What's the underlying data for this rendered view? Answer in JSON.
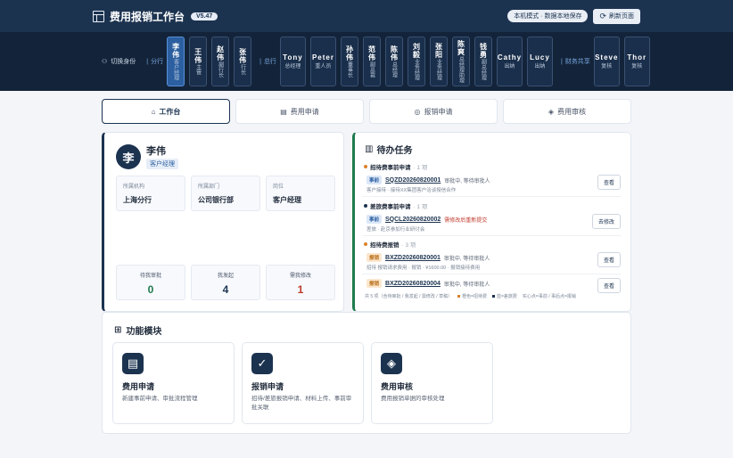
{
  "header": {
    "title": "费用报销工作台",
    "version": "V5.47",
    "mode_pill": "本机模式 · 数据本地保存",
    "refresh_label": "刷新页面"
  },
  "idbar": {
    "switch_label": "切换身份",
    "groups": {
      "branch": "分行",
      "head": "总行",
      "shared": "财务共享"
    },
    "branch_users": [
      {
        "name": "李伟",
        "role": "客户经理",
        "active": true
      },
      {
        "name": "王伟",
        "role": "主管"
      },
      {
        "name": "赵伟",
        "role": "副行长"
      },
      {
        "name": "张伟",
        "role": "行长"
      }
    ],
    "head_users": [
      {
        "name": "Tony",
        "role": "总经理",
        "en": true
      },
      {
        "name": "Peter",
        "role": "重人员",
        "en": true
      },
      {
        "name": "孙伟",
        "role": "董事长"
      },
      {
        "name": "范伟",
        "role": "副总裁"
      },
      {
        "name": "陈伟",
        "role": "总经理"
      },
      {
        "name": "刘毅",
        "role": "业务经理"
      },
      {
        "name": "张阳",
        "role": "业务经理"
      },
      {
        "name": "陈爽",
        "role": "总经理助理"
      },
      {
        "name": "钱勇",
        "role": "副总经理"
      },
      {
        "name": "Cathy",
        "role": "出纳",
        "en": true
      },
      {
        "name": "Lucy",
        "role": "出纳",
        "en": true
      }
    ],
    "shared_users": [
      {
        "name": "Steve",
        "role": "复核",
        "en": true
      },
      {
        "name": "Thor",
        "role": "复核",
        "en": true
      }
    ]
  },
  "tabs": [
    {
      "label": "工作台",
      "icon": "home-icon",
      "active": true
    },
    {
      "label": "费用申请",
      "icon": "document-icon"
    },
    {
      "label": "报销申请",
      "icon": "check-circle-icon"
    },
    {
      "label": "费用审核",
      "icon": "layers-icon"
    }
  ],
  "profile": {
    "avatar": "李",
    "name": "李伟",
    "role": "客户经理",
    "info": [
      {
        "k": "所属机构",
        "v": "上海分行"
      },
      {
        "k": "所属部门",
        "v": "公司银行部"
      },
      {
        "k": "岗位",
        "v": "客户经理"
      }
    ],
    "stats": [
      {
        "k": "待我审批",
        "v": "0",
        "color": "#1f7a4d"
      },
      {
        "k": "我发起",
        "v": "4",
        "color": "#1c3350"
      },
      {
        "k": "需我修改",
        "v": "1",
        "color": "#c0392b"
      }
    ]
  },
  "todo": {
    "title": "待办任务",
    "sections": [
      {
        "label": "招待费事前申请",
        "count": "· 1 项",
        "color": "#d9822b"
      },
      {
        "label": "差旅费事前申请",
        "count": "· 1 项",
        "color": "#1c3350"
      },
      {
        "label": "招待费报销",
        "count": "· 3 项",
        "color": "#d9822b"
      }
    ],
    "items": [
      {
        "tag": "事前",
        "code": "SQZD20260820001",
        "status": "审批中, 等待审批人",
        "desc": "客户接待 · 接待XX集团客户洽谈授信合作",
        "action": "查看"
      },
      {
        "tag": "事前",
        "code": "SQCL20260820002",
        "status": "需修改后重新提交",
        "desc": "差旅 · 赴京参加行业研讨会",
        "action": "去修改"
      },
      {
        "tag": "报销",
        "code": "BXZD20260820001",
        "status": "审批中, 等待审批人",
        "desc": "招待 报销请求费用 · 报销 · ¥1600.00 · 报销接待费用",
        "action": "查看"
      },
      {
        "tag": "报销",
        "code": "BXZD20260820004",
        "status": "审批中, 等待审批人",
        "desc": "",
        "action": "查看"
      }
    ],
    "footer": "共 5 项（含待审批 / 我发起 / 需修改 / 草稿）",
    "legend": [
      "橙色=招待费",
      "蓝=差旅费",
      "实心点=事前 / 事后点=报销"
    ]
  },
  "modules": {
    "title": "功能模块",
    "items": [
      {
        "title": "费用申请",
        "desc": "新建事前申请、审批流程管理",
        "icon": "document-icon"
      },
      {
        "title": "报销申请",
        "desc": "招待/差旅报销申请、材料上传、事前审批关联",
        "icon": "check-circle-icon"
      },
      {
        "title": "费用审核",
        "desc": "费用报销单据的审核处理",
        "icon": "layers-icon"
      }
    ]
  }
}
